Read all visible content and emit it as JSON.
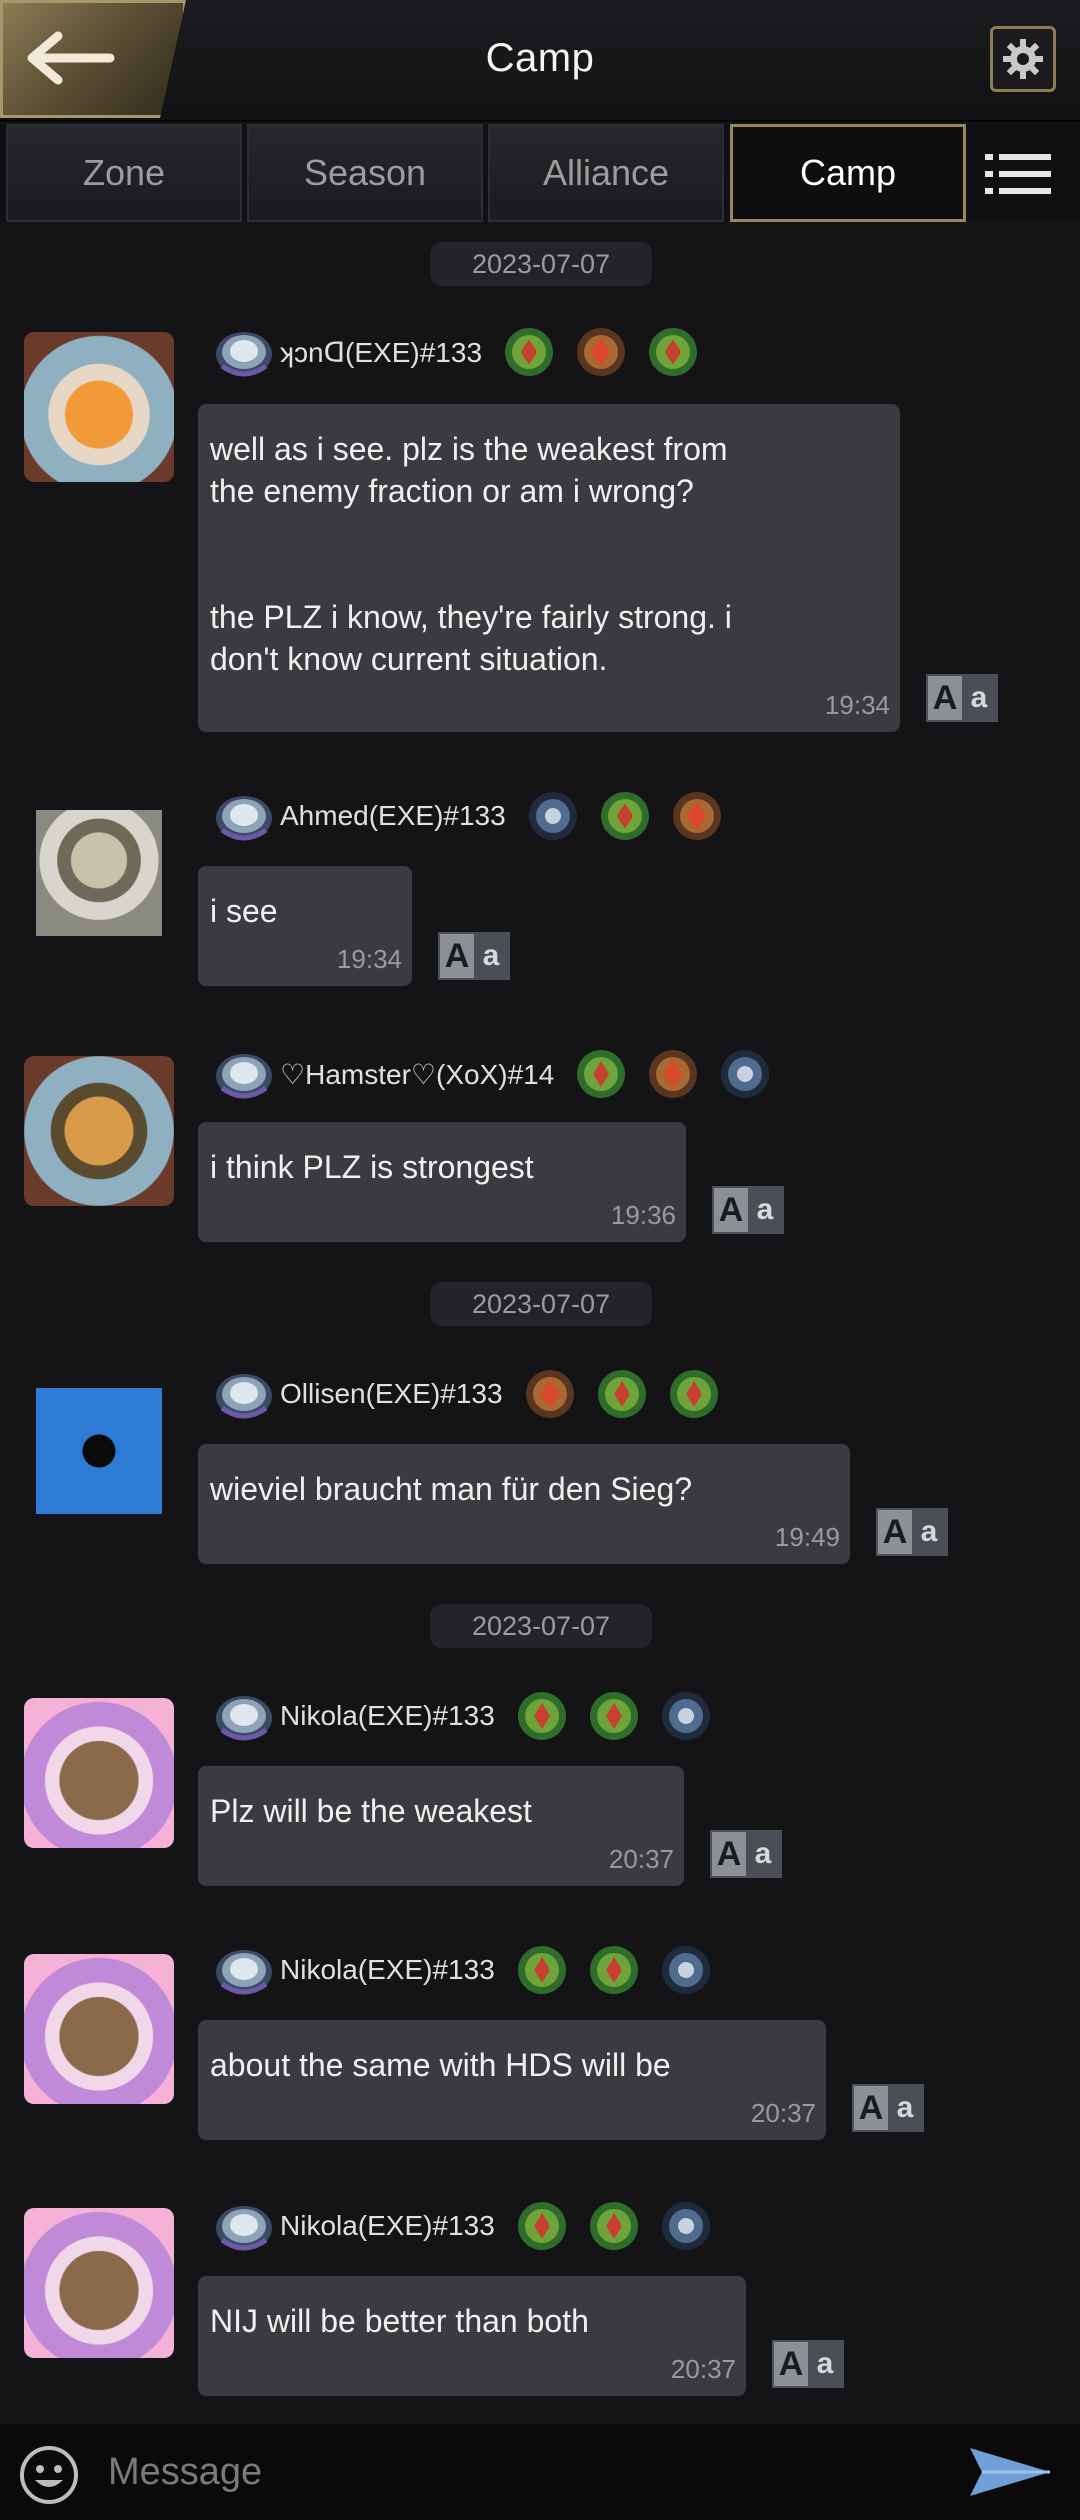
{
  "header": {
    "title": "Camp"
  },
  "tabs": [
    {
      "label": "Zone"
    },
    {
      "label": "Season"
    },
    {
      "label": "Alliance"
    },
    {
      "label": "Camp"
    }
  ],
  "dates": [
    "2023-07-07",
    "2023-07-07",
    "2023-07-07"
  ],
  "messages": [
    {
      "user": "ʞɔnᗡ(EXE)#133",
      "text": "well as i see. plz is the weakest from\nthe enemy fraction or am i wrong?\n\n\nthe PLZ i know, they're fairly strong. i\ndon't know current situation.",
      "time": "19:34"
    },
    {
      "user": "Ahmed(EXE)#133",
      "text": "i see",
      "time": "19:34"
    },
    {
      "user": "♡Hamster♡(XoX)#14",
      "text": "i think PLZ is strongest",
      "time": "19:36"
    },
    {
      "user": "Ollisen(EXE)#133",
      "text": "wieviel braucht man für den Sieg?",
      "time": "19:49"
    },
    {
      "user": "Nikola(EXE)#133",
      "text": "Plz will be the weakest",
      "time": "20:37"
    },
    {
      "user": "Nikola(EXE)#133",
      "text": "about the same with HDS will be",
      "time": "20:37"
    },
    {
      "user": "Nikola(EXE)#133",
      "text": "NIJ will be better than both",
      "time": "20:37"
    }
  ],
  "translate": {
    "big": "A",
    "small": "a"
  },
  "input": {
    "placeholder": "Message"
  },
  "colors": {
    "accent_gold": "#9a875b",
    "bubble": "#3a3b3f",
    "background": "#141416"
  }
}
